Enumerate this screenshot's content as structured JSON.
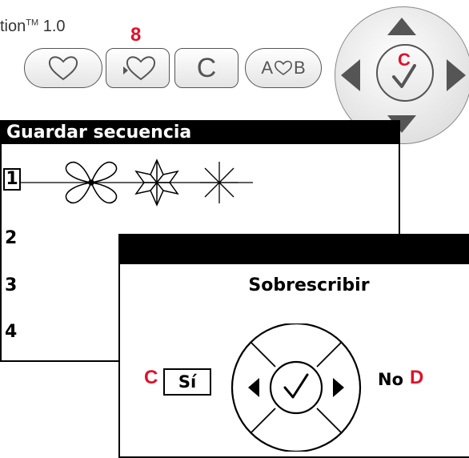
{
  "header": {
    "product_name": "tion",
    "trademark": "TM",
    "version": "1.0"
  },
  "callouts": {
    "buttons_marker": "8",
    "wheel_marker": "C",
    "yes_marker": "C",
    "no_marker": "D"
  },
  "controls": {
    "favorite_icon": "heart-icon",
    "favorite_arrow_icon": "heart-arrow-icon",
    "clear_label": "C",
    "ab_label_a": "A",
    "ab_label_b": "B",
    "ab_icon": "heart-icon",
    "wheel_icon": "check-circle-icon"
  },
  "save_sequence": {
    "title": "Guardar secuencia",
    "slots": [
      {
        "number": "1",
        "selected": true,
        "has_stitches": true
      },
      {
        "number": "2",
        "selected": false,
        "has_stitches": false
      },
      {
        "number": "3",
        "selected": false,
        "has_stitches": false
      },
      {
        "number": "4",
        "selected": false,
        "has_stitches": false
      }
    ]
  },
  "overwrite_dialog": {
    "title": "Sobrescribir",
    "yes_label": "Sí",
    "no_label": "No"
  },
  "colors": {
    "callout": "#e0112b",
    "button_border": "#555555",
    "panel_bar": "#000000"
  }
}
